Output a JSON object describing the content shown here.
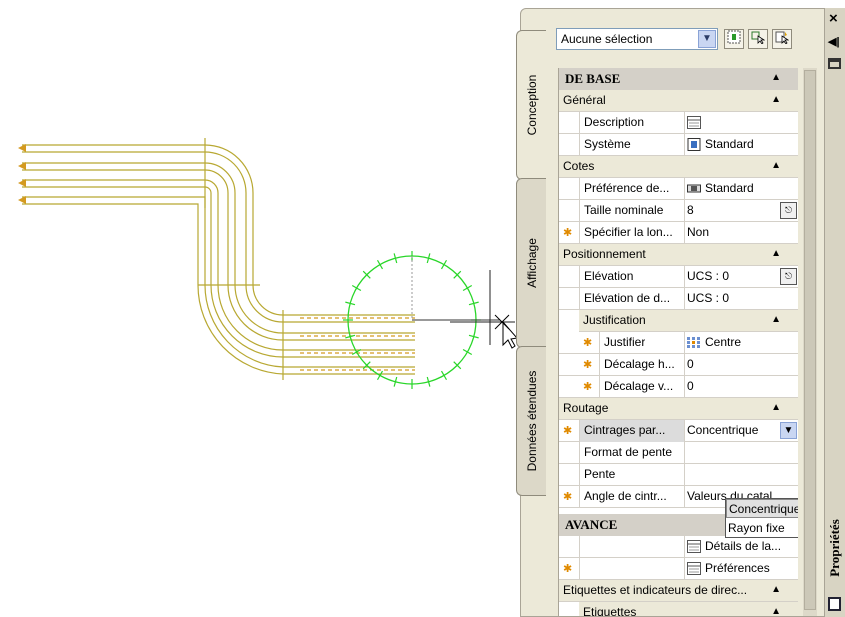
{
  "palette": {
    "title": "Propriétés",
    "tabs": [
      "Conception",
      "Affichage",
      "Données étendues"
    ],
    "selection": "Aucune sélection",
    "colors": {
      "pipe": "#b8a832",
      "circle": "#29d629",
      "accent_star": "#e08a00"
    }
  },
  "grid": {
    "de_base": "DE BASE",
    "general": "Général",
    "description_label": "Description",
    "systeme_label": "Système",
    "systeme_value": "Standard",
    "cotes": "Cotes",
    "pref_label": "Préférence de...",
    "pref_value": "Standard",
    "taille_label": "Taille nominale",
    "taille_value": "8",
    "specifier_label": "Spécifier la lon...",
    "specifier_value": "Non",
    "positionnement": "Positionnement",
    "elevation_label": "Elévation",
    "elevation_value": "UCS : 0",
    "elevation_d_label": "Elévation de d...",
    "elevation_d_value": "UCS : 0",
    "justification": "Justification",
    "justifier_label": "Justifier",
    "justifier_value": "Centre",
    "decalage_h_label": "Décalage h...",
    "decalage_h_value": "0",
    "decalage_v_label": "Décalage v...",
    "decalage_v_value": "0",
    "routage": "Routage",
    "cintrages_label": "Cintrages par...",
    "cintrages_value": "Concentrique",
    "format_label": "Format de pente",
    "pente_label": "Pente",
    "angle_label": "Angle de cintr...",
    "angle_value": "Valeurs du catal...",
    "avance": "AVANCE",
    "details_value": "Détails de la...",
    "preferences_value": "Préférences",
    "etiquettes_group": "Etiquettes et indicateurs de direc...",
    "etiquettes_label": "Etiquettes",
    "dropdown_options": [
      "Concentrique",
      "Rayon fixe"
    ]
  }
}
